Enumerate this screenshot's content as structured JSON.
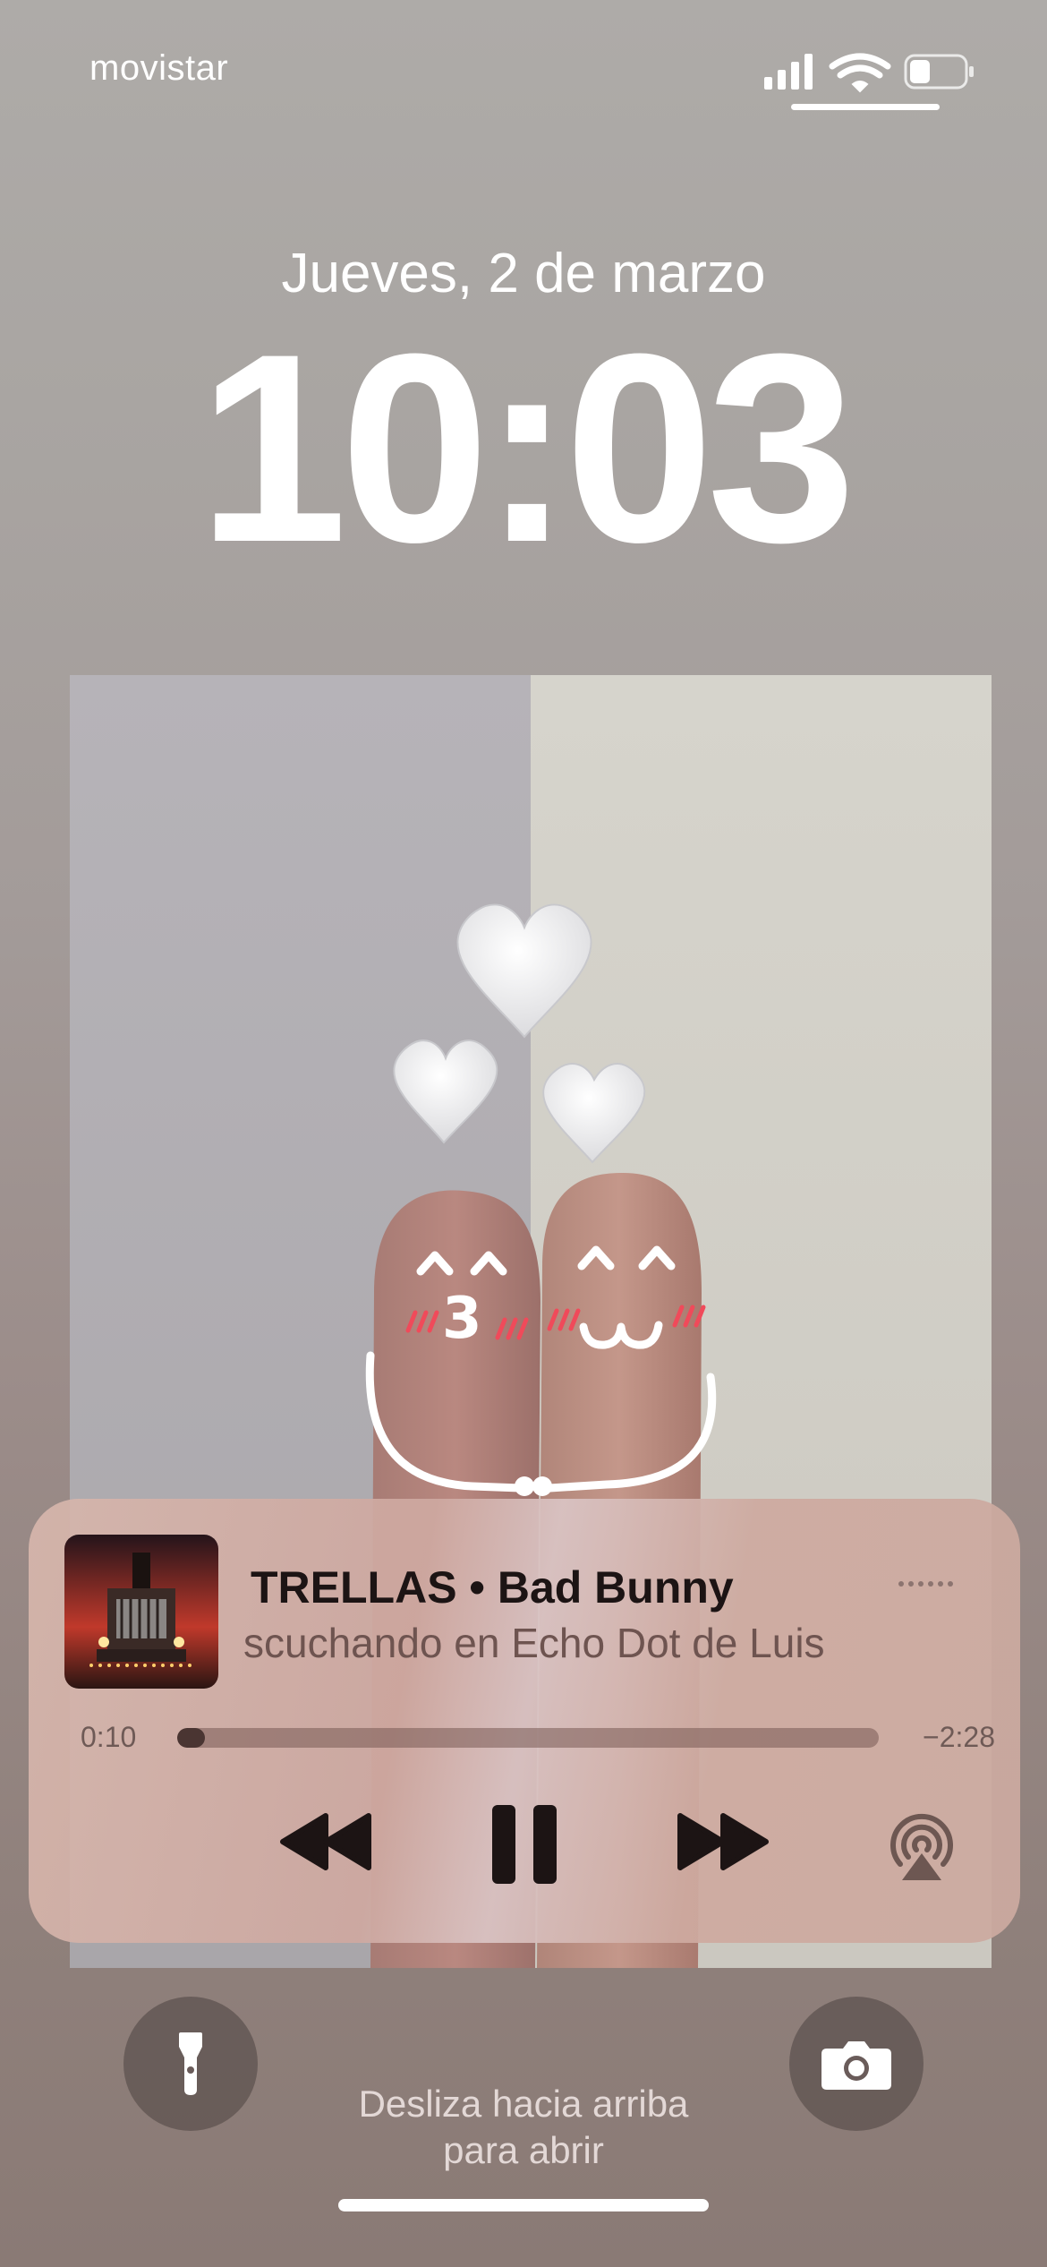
{
  "status_bar": {
    "carrier": "movistar",
    "icons": [
      "cellular-signal-icon",
      "wifi-icon",
      "battery-icon"
    ]
  },
  "lock_screen": {
    "date": "Jueves, 2 de marzo",
    "time": "10:03"
  },
  "wallpaper": {
    "left_face_mouth": "3"
  },
  "now_playing": {
    "title": "TRELLAS • Bad Bunny",
    "subtitle": "scuchando en Echo Dot de Luis",
    "elapsed": "0:10",
    "remaining": "−2:28",
    "progress": 0.04,
    "controls": [
      "rewind-icon",
      "pause-icon",
      "fast-forward-icon",
      "airplay-icon"
    ]
  },
  "bottom": {
    "hint_line1": "Desliza hacia arriba",
    "hint_line2": "para abrir",
    "flashlight_icon": "flashlight-icon",
    "camera_icon": "camera-icon"
  },
  "colors": {
    "widget_text": "#1c1414",
    "progress_fill": "#4a3532",
    "blush": "#f04a5a"
  }
}
